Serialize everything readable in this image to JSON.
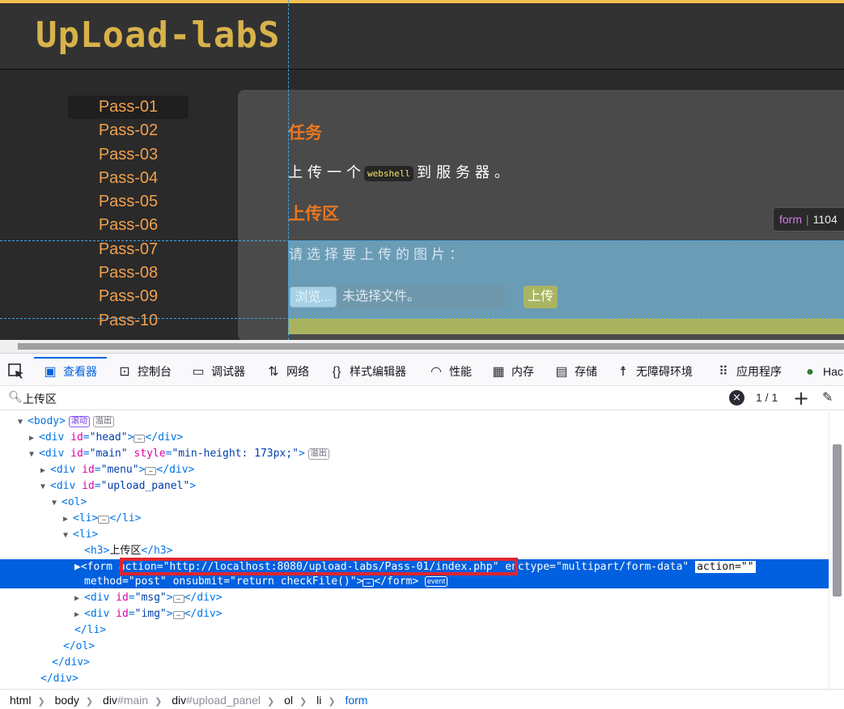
{
  "page": {
    "logo": "UpLoad-labS",
    "menu": [
      "Pass-01",
      "Pass-02",
      "Pass-03",
      "Pass-04",
      "Pass-05",
      "Pass-06",
      "Pass-07",
      "Pass-08",
      "Pass-09",
      "Pass-10"
    ],
    "task_title": "任务",
    "task_text_before": "上传一个",
    "task_code": "webshell",
    "task_text_after": "到服务器。",
    "upload_title": "上传区",
    "form_label": "请选择要上传的图片：",
    "browse_label": "浏览...",
    "file_status": "未选择文件。",
    "submit_label": "上传",
    "tooltip_tag": "form",
    "tooltip_dim": "1104"
  },
  "devtools": {
    "tabs": [
      {
        "label": "查看器",
        "icon": "inspector-icon"
      },
      {
        "label": "控制台",
        "icon": "console-icon"
      },
      {
        "label": "调试器",
        "icon": "debugger-icon"
      },
      {
        "label": "网络",
        "icon": "network-icon"
      },
      {
        "label": "样式编辑器",
        "icon": "style-editor-icon"
      },
      {
        "label": "性能",
        "icon": "performance-icon"
      },
      {
        "label": "内存",
        "icon": "memory-icon"
      },
      {
        "label": "存储",
        "icon": "storage-icon"
      },
      {
        "label": "无障碍环境",
        "icon": "accessibility-icon"
      },
      {
        "label": "应用程序",
        "icon": "application-icon"
      },
      {
        "label": "Hac",
        "icon": "hackbar-icon"
      }
    ],
    "search_query": "上传区",
    "search_count": "1 / 1",
    "badges": {
      "scroll": "滚动",
      "overflow": "溢出",
      "event": "event"
    },
    "tree": {
      "body_tag": "<body>",
      "head_div": {
        "open": "<div ",
        "attr": "id",
        "val": "\"head\"",
        "close": "</div>"
      },
      "main_div": {
        "open": "<div ",
        "attr": "id",
        "val": "\"main\"",
        "style_attr": "style",
        "style_val": "\"min-height: 173px;\"",
        "end": ">"
      },
      "menu_div": {
        "open": "<div ",
        "attr": "id",
        "val": "\"menu\"",
        "close": "</div>"
      },
      "upload_div": {
        "open": "<div ",
        "attr": "id",
        "val": "\"upload_panel\"",
        "end": ">"
      },
      "ol_open": "<ol>",
      "li_collapsed": {
        "open": "<li>",
        "close": "</li>"
      },
      "li_open": "<li>",
      "h3_line": {
        "open": "<h3>",
        "text": "上传区",
        "close": "</h3>"
      },
      "form_line1": {
        "open": "<form ",
        "action_attr": "action",
        "action_val": "\"http://localhost:8080/upload-labs/Pass-01/index.php\"",
        "enctype_attr": "enctype",
        "enctype_val": "\"multipart/form-data\"",
        "action2_attr": "action",
        "action2_val": "\"\""
      },
      "form_line2": {
        "method_attr": "method",
        "method_val": "\"post\"",
        "onsubmit_attr": "onsubmit",
        "onsubmit_val": "\"return checkFile()\"",
        "end": ">",
        "close": "</form>"
      },
      "msg_div": {
        "open": "<div ",
        "attr": "id",
        "val": "\"msg\"",
        "close": "</div>"
      },
      "img_div": {
        "open": "<div ",
        "attr": "id",
        "val": "\"img\"",
        "close": "</div>"
      },
      "li_close": "</li>",
      "ol_close": "</ol>",
      "div_close1": "</div>",
      "div_close2": "</div>"
    },
    "breadcrumbs": [
      {
        "tag": "html",
        "hash": ""
      },
      {
        "tag": "body",
        "hash": ""
      },
      {
        "tag": "div",
        "hash": "#main"
      },
      {
        "tag": "div",
        "hash": "#upload_panel"
      },
      {
        "tag": "ol",
        "hash": ""
      },
      {
        "tag": "li",
        "hash": ""
      },
      {
        "tag": "form",
        "hash": ""
      }
    ]
  }
}
